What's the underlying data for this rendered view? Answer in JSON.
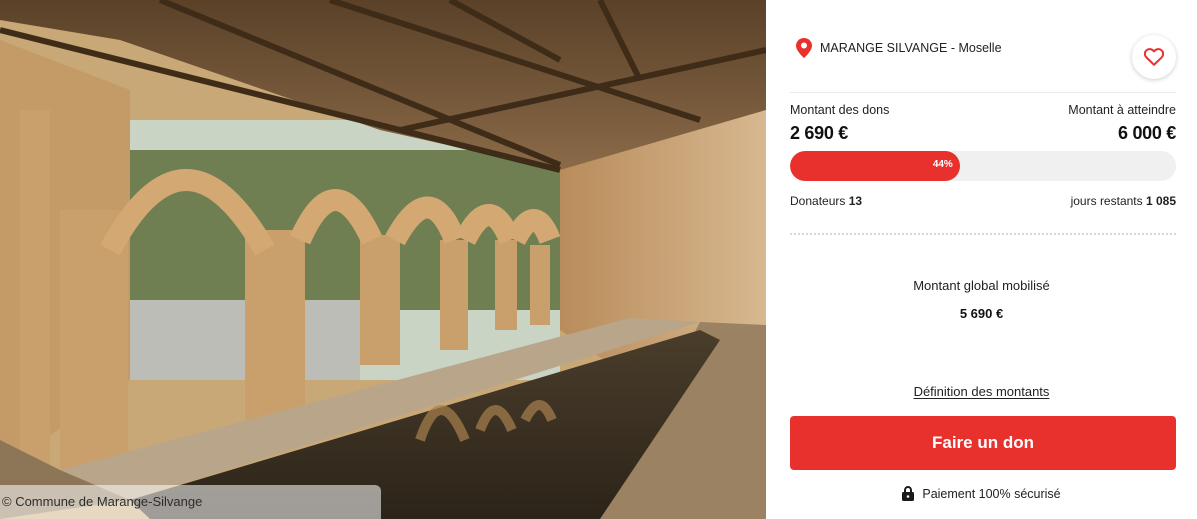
{
  "photo": {
    "alt": "Lavoir de Marange-Silvange",
    "caption": "© Commune de Marange-Silvange"
  },
  "campaign": {
    "location_city": "MARANGE SILVANGE",
    "location_separator": " - ",
    "location_region": "Moselle",
    "donations_label": "Montant des dons",
    "donations_amount": "2 690 €",
    "target_label": "Montant à atteindre",
    "target_amount": "6 000 €",
    "progress_percent": 44,
    "progress_label": "44%",
    "donors_label": "Donateurs",
    "donors_count": "13",
    "days_label": "jours restants",
    "days_count": "1 085",
    "global_label": "Montant global mobilisé",
    "global_amount": "5 690 €",
    "definition_link": "Définition des montants",
    "donate_button": "Faire un don",
    "secure_text": "Paiement 100% sécurisé"
  },
  "icons": {
    "location": "map-pin-icon",
    "favorite": "heart-icon",
    "secure": "lock-icon"
  },
  "colors": {
    "accent": "#e8302d",
    "track": "#f0f0f0"
  }
}
